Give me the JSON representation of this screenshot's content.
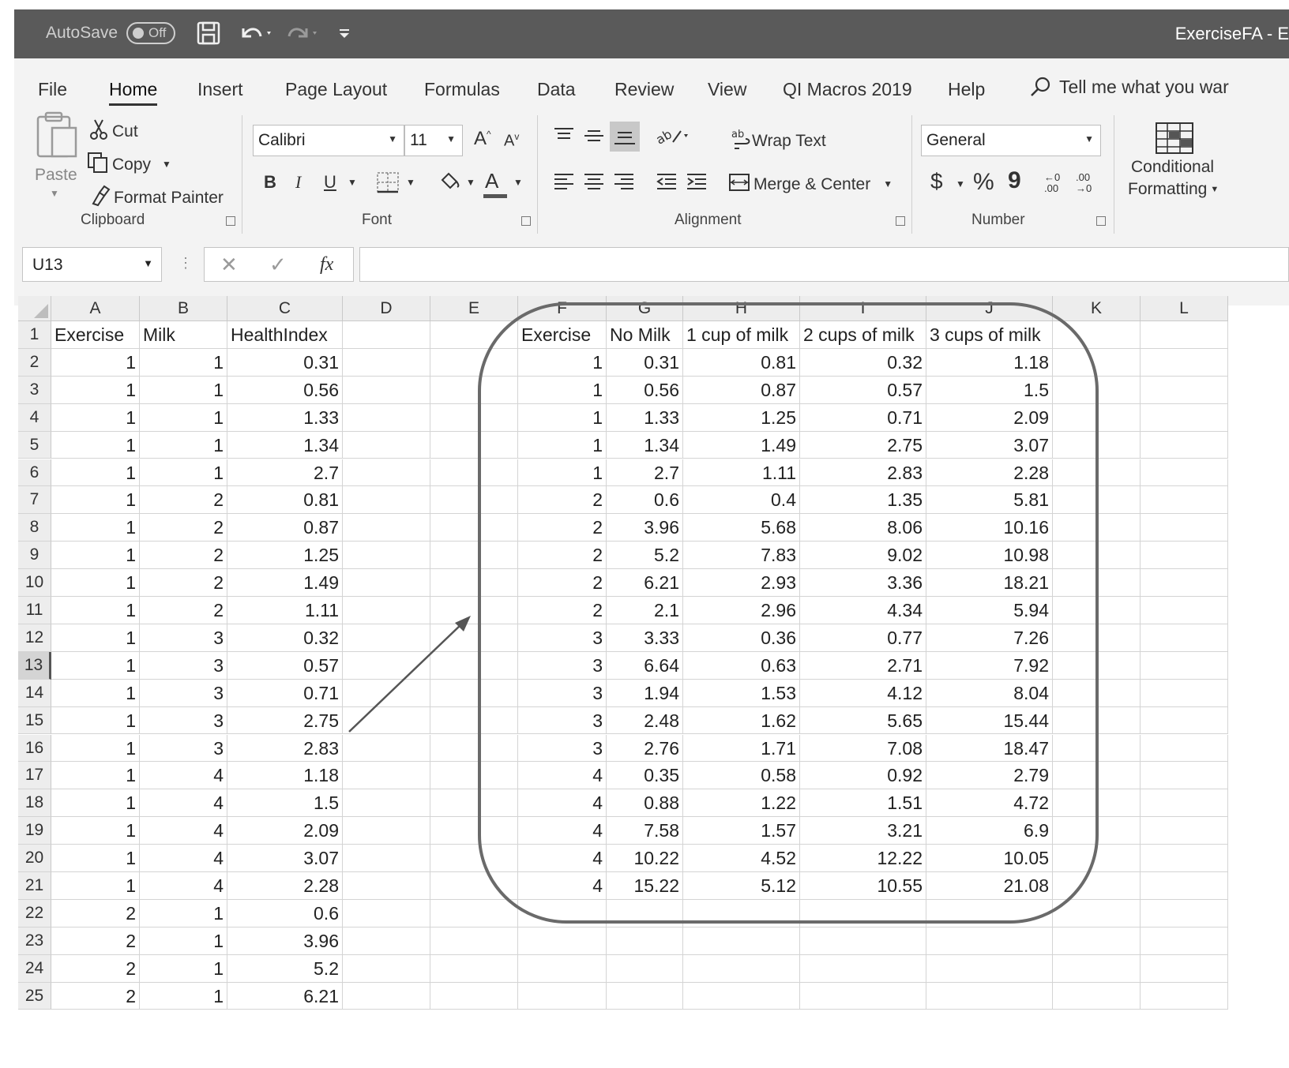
{
  "titlebar": {
    "autosave_label": "AutoSave",
    "autosave_state": "Off",
    "document_title": "ExerciseFA - E"
  },
  "menu": {
    "items": [
      "File",
      "Home",
      "Insert",
      "Page Layout",
      "Formulas",
      "Data",
      "Review",
      "View",
      "QI Macros 2019",
      "Help"
    ],
    "active": "Home",
    "tell_me": "Tell me what you war"
  },
  "ribbon": {
    "clipboard": {
      "paste": "Paste",
      "cut": "Cut",
      "copy": "Copy",
      "format_painter": "Format Painter",
      "group_label": "Clipboard"
    },
    "font": {
      "font_name": "Calibri",
      "font_size": "11",
      "grow": "A",
      "shrink": "A",
      "bold": "B",
      "italic": "I",
      "underline": "U",
      "font_color_glyph": "A",
      "group_label": "Font"
    },
    "alignment": {
      "wrap_text": "Wrap Text",
      "merge_center": "Merge & Center",
      "group_label": "Alignment"
    },
    "number": {
      "format": "General",
      "currency": "$",
      "percent": "%",
      "comma": "9",
      "inc_decimal": ".00",
      "dec_decimal": ".00",
      "group_label": "Number"
    },
    "styles": {
      "conditional_formatting_line1": "Conditional",
      "conditional_formatting_line2": "Formatting"
    }
  },
  "formula_bar": {
    "name_box": "U13",
    "cancel": "✕",
    "enter": "✓",
    "fx": "fx",
    "formula": ""
  },
  "sheet": {
    "selected_row": 13,
    "columns": [
      "A",
      "B",
      "C",
      "D",
      "E",
      "F",
      "G",
      "H",
      "I",
      "J",
      "K",
      "L"
    ],
    "row_numbers": [
      "1",
      "2",
      "3",
      "4",
      "5",
      "6",
      "7",
      "8",
      "9",
      "10",
      "11",
      "12",
      "13",
      "14",
      "15",
      "16",
      "17",
      "18",
      "19",
      "20",
      "21",
      "22",
      "23",
      "24",
      "25"
    ],
    "left_header": [
      "Exercise",
      "Milk",
      "HealthIndex"
    ],
    "left_rows": [
      [
        "1",
        "1",
        "0.31"
      ],
      [
        "1",
        "1",
        "0.56"
      ],
      [
        "1",
        "1",
        "1.33"
      ],
      [
        "1",
        "1",
        "1.34"
      ],
      [
        "1",
        "1",
        "2.7"
      ],
      [
        "1",
        "2",
        "0.81"
      ],
      [
        "1",
        "2",
        "0.87"
      ],
      [
        "1",
        "2",
        "1.25"
      ],
      [
        "1",
        "2",
        "1.49"
      ],
      [
        "1",
        "2",
        "1.11"
      ],
      [
        "1",
        "3",
        "0.32"
      ],
      [
        "1",
        "3",
        "0.57"
      ],
      [
        "1",
        "3",
        "0.71"
      ],
      [
        "1",
        "3",
        "2.75"
      ],
      [
        "1",
        "3",
        "2.83"
      ],
      [
        "1",
        "4",
        "1.18"
      ],
      [
        "1",
        "4",
        "1.5"
      ],
      [
        "1",
        "4",
        "2.09"
      ],
      [
        "1",
        "4",
        "3.07"
      ],
      [
        "1",
        "4",
        "2.28"
      ],
      [
        "2",
        "1",
        "0.6"
      ],
      [
        "2",
        "1",
        "3.96"
      ],
      [
        "2",
        "1",
        "5.2"
      ],
      [
        "2",
        "1",
        "6.21"
      ]
    ],
    "right_header": [
      "Exercise",
      "No Milk",
      "1 cup of milk",
      "2 cups of milk",
      "3 cups of milk"
    ],
    "right_rows": [
      [
        "1",
        "0.31",
        "0.81",
        "0.32",
        "1.18"
      ],
      [
        "1",
        "0.56",
        "0.87",
        "0.57",
        "1.5"
      ],
      [
        "1",
        "1.33",
        "1.25",
        "0.71",
        "2.09"
      ],
      [
        "1",
        "1.34",
        "1.49",
        "2.75",
        "3.07"
      ],
      [
        "1",
        "2.7",
        "1.11",
        "2.83",
        "2.28"
      ],
      [
        "2",
        "0.6",
        "0.4",
        "1.35",
        "5.81"
      ],
      [
        "2",
        "3.96",
        "5.68",
        "8.06",
        "10.16"
      ],
      [
        "2",
        "5.2",
        "7.83",
        "9.02",
        "10.98"
      ],
      [
        "2",
        "6.21",
        "2.93",
        "3.36",
        "18.21"
      ],
      [
        "2",
        "2.1",
        "2.96",
        "4.34",
        "5.94"
      ],
      [
        "3",
        "3.33",
        "0.36",
        "0.77",
        "7.26"
      ],
      [
        "3",
        "6.64",
        "0.63",
        "2.71",
        "7.92"
      ],
      [
        "3",
        "1.94",
        "1.53",
        "4.12",
        "8.04"
      ],
      [
        "3",
        "2.48",
        "1.62",
        "5.65",
        "15.44"
      ],
      [
        "3",
        "2.76",
        "1.71",
        "7.08",
        "18.47"
      ],
      [
        "4",
        "0.35",
        "0.58",
        "0.92",
        "2.79"
      ],
      [
        "4",
        "0.88",
        "1.22",
        "1.51",
        "4.72"
      ],
      [
        "4",
        "7.58",
        "1.57",
        "3.21",
        "6.9"
      ],
      [
        "4",
        "10.22",
        "4.52",
        "12.22",
        "10.05"
      ],
      [
        "4",
        "15.22",
        "5.12",
        "10.55",
        "21.08"
      ]
    ]
  }
}
